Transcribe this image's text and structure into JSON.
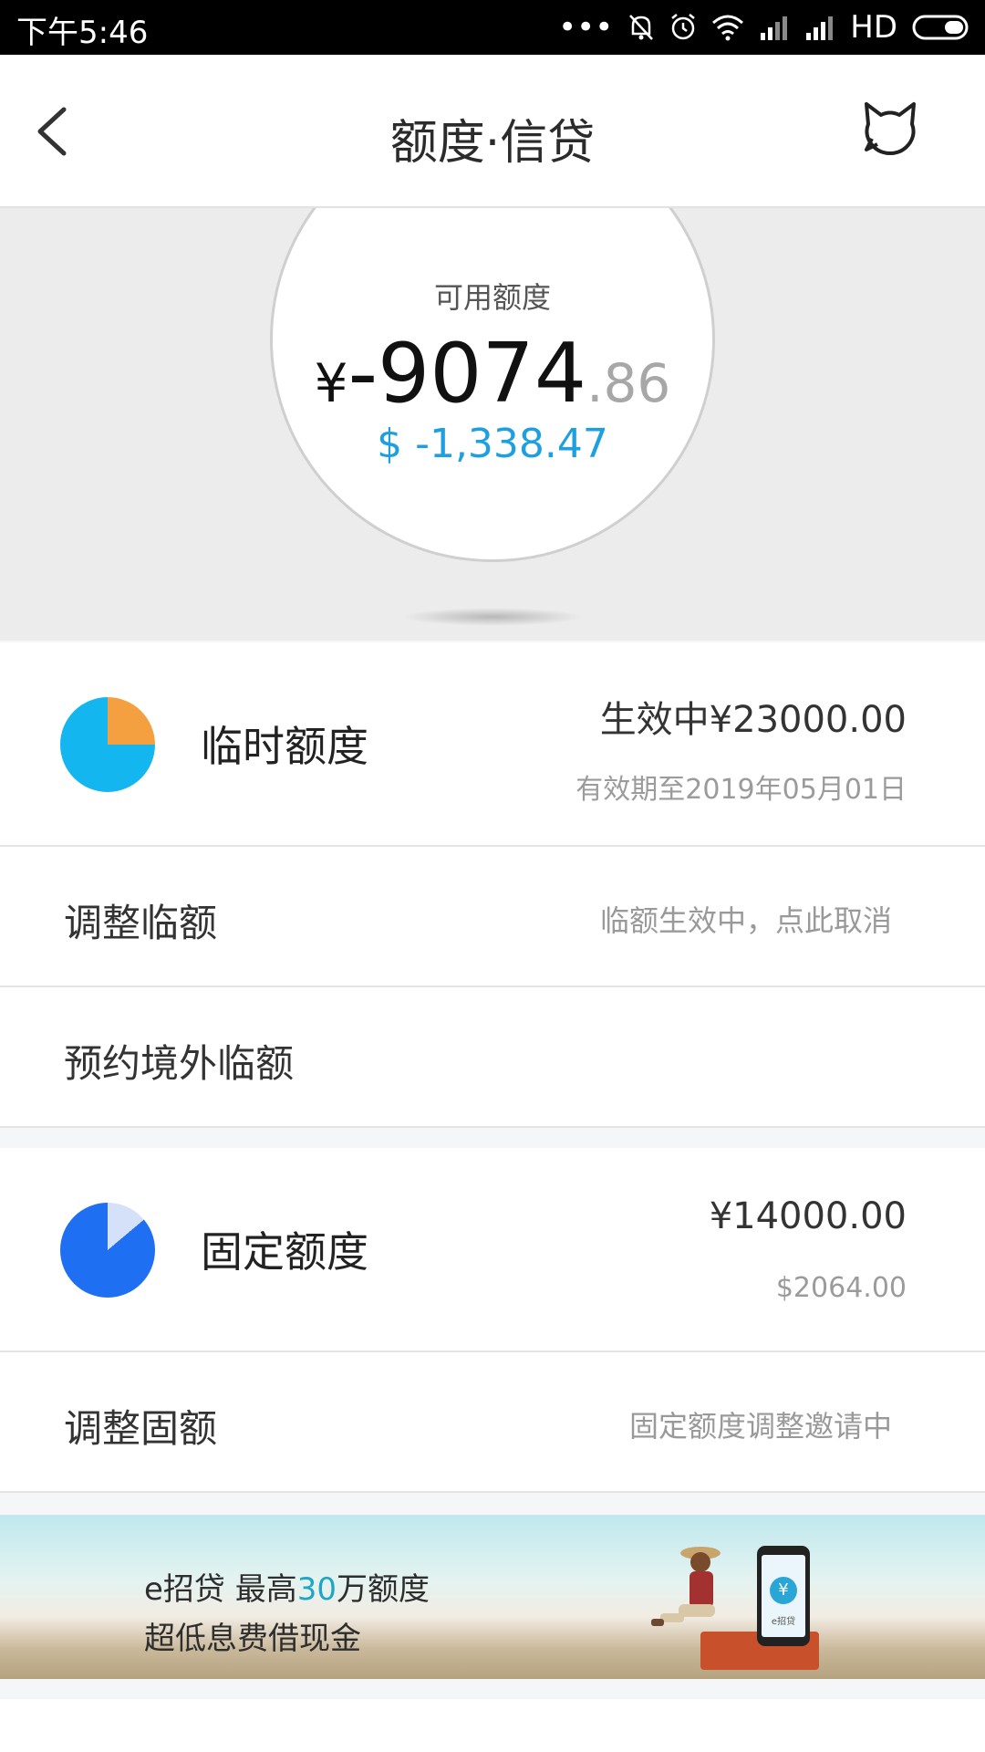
{
  "status_bar": {
    "time": "下午5:46",
    "dots": "•••",
    "network": "HD"
  },
  "nav": {
    "title": "额度·信贷"
  },
  "available": {
    "label": "可用额度",
    "currency": "¥",
    "integer": "-9074",
    "decimal": ".86",
    "usd": "$ -1,338.47"
  },
  "temp_limit": {
    "title": "临时额度",
    "value": "生效中¥23000.00",
    "sub": "有效期至2019年05月01日"
  },
  "adjust_temp": {
    "label": "调整临额",
    "status": "临额生效中，点此取消"
  },
  "overseas_temp": {
    "label": "预约境外临额"
  },
  "fixed_limit": {
    "title": "固定额度",
    "value": "¥14000.00",
    "sub": "$2064.00"
  },
  "adjust_fixed": {
    "label": "调整固额",
    "status": "固定额度调整邀请中"
  },
  "banner": {
    "line1_prefix": "e招贷  最高",
    "line1_highlight": "30",
    "line1_suffix": "万额度",
    "line2": "超低息费借现金",
    "phone_brand": "e招贷"
  },
  "colors": {
    "accent_blue": "#1ea0e0",
    "pie_temp": [
      "#f5a040",
      "#14b6f0"
    ],
    "pie_fixed": [
      "#d4e1f8",
      "#1f6ff2"
    ]
  }
}
